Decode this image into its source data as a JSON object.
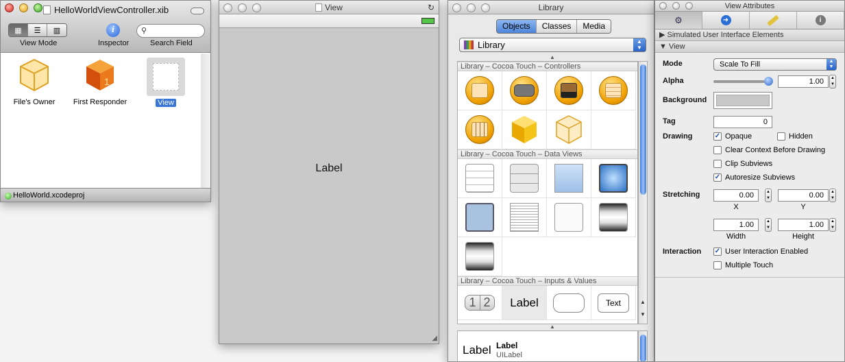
{
  "xib_window": {
    "title": "HelloWorldViewController.xib",
    "toolbar": {
      "view_mode_label": "View Mode",
      "inspector_label": "Inspector",
      "search_field_label": "Search Field",
      "view_mode_options": [
        "icon-grid",
        "list",
        "columns"
      ]
    },
    "items": [
      {
        "label": "File's Owner",
        "icon": "files-owner-cube-icon"
      },
      {
        "label": "First Responder",
        "icon": "first-responder-cube-icon"
      },
      {
        "label": "View",
        "icon": "view-icon",
        "selected": true
      }
    ],
    "status": "HelloWorld.xcodeproj"
  },
  "view_window": {
    "title": "View",
    "label_text": "Label"
  },
  "library_window": {
    "title": "Library",
    "tabs": [
      "Objects",
      "Classes",
      "Media"
    ],
    "active_tab": "Objects",
    "popup_value": "Library",
    "sections": [
      {
        "title": "Library – Cocoa Touch – Controllers",
        "items": [
          "view-controller-icon",
          "navigation-controller-icon",
          "tab-bar-controller-icon",
          "table-view-controller-icon",
          "image-picker-icon",
          "object-icon",
          "external-object-icon"
        ]
      },
      {
        "title": "Library – Cocoa Touch – Data Views",
        "items": [
          "table-view-icon",
          "table-view-cell-icon",
          "image-view-icon",
          "web-view-icon",
          "map-view-icon",
          "text-view-icon",
          "scroll-view-icon",
          "picker-view-icon",
          "date-picker-icon"
        ]
      },
      {
        "title": "Library – Cocoa Touch – Inputs & Values",
        "items": [
          "segmented-control-icon",
          "label-icon",
          "text-field-icon",
          "round-rect-button-icon"
        ]
      }
    ],
    "inputs_row": {
      "segment_1": "1",
      "segment_2": "2",
      "label": "Label",
      "button": "Text"
    },
    "detail": {
      "preview": "Label",
      "name": "Label",
      "class": "UILabel"
    }
  },
  "inspector": {
    "title": "View Attributes",
    "tabs": [
      "attributes-icon",
      "connections-icon",
      "size-icon",
      "identity-icon"
    ],
    "sections": [
      "Simulated User Interface Elements",
      "View"
    ],
    "mode_label": "Mode",
    "mode_value": "Scale To Fill",
    "alpha_label": "Alpha",
    "alpha_value": "1.00",
    "background_label": "Background",
    "background_color": "#c8c8c8",
    "tag_label": "Tag",
    "tag_value": "0",
    "drawing_label": "Drawing",
    "opaque": {
      "label": "Opaque",
      "checked": true
    },
    "hidden": {
      "label": "Hidden",
      "checked": false
    },
    "clear_context": {
      "label": "Clear Context Before Drawing",
      "checked": false
    },
    "clip_subviews": {
      "label": "Clip Subviews",
      "checked": false
    },
    "autoresize": {
      "label": "Autoresize Subviews",
      "checked": true
    },
    "stretching_label": "Stretching",
    "stretch_x": "0.00",
    "stretch_y": "0.00",
    "x_label": "X",
    "y_label": "Y",
    "stretch_width": "1.00",
    "stretch_height": "1.00",
    "width_label": "Width",
    "height_label": "Height",
    "interaction_label": "Interaction",
    "user_interaction": {
      "label": "User Interaction Enabled",
      "checked": true
    },
    "multiple_touch": {
      "label": "Multiple Touch",
      "checked": false
    }
  },
  "colors": {
    "selection": "#3875d7",
    "accent_gold": "#f0a000",
    "view_bg": "#c9c9c9"
  }
}
